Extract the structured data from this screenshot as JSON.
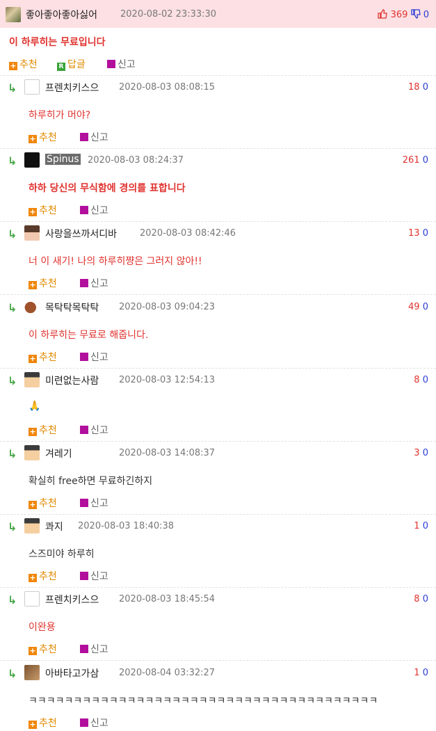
{
  "main_post": {
    "author": "좋아좋아좋아싫어",
    "date": "2020-08-02 23:33:30",
    "up": "369",
    "down": "0",
    "text": "이 하루히는 무료입니다",
    "actions": {
      "recommend": "추천",
      "reply": "답글",
      "report": "신고"
    }
  },
  "action_labels": {
    "recommend": "추천",
    "report": "신고"
  },
  "comments": [
    {
      "author": "프렌치키스으",
      "date": "2020-08-03 08:08:15",
      "up": "18",
      "down": "0",
      "text": "하루히가 머야?",
      "color": "#e0322e",
      "bold": false,
      "avatar": "lips-avatar"
    },
    {
      "author": "Spinus",
      "date": "2020-08-03 08:24:37",
      "up": "261",
      "down": "0",
      "text": "하하 당신의 무식함에 경의를 표합니다",
      "color": "#e0322e",
      "bold": true,
      "avatar": "cat-avatar"
    },
    {
      "author": "사랑을쓰까서디바",
      "date": "2020-08-03 08:42:46",
      "up": "13",
      "down": "0",
      "text": "너 이 새기! 나의 하루히쨩은 그러지 않아!!",
      "color": "#e0322e",
      "bold": false,
      "avatar": "girl-avatar"
    },
    {
      "author": "목탁탁목탁탁",
      "date": "2020-08-03 09:04:23",
      "up": "49",
      "down": "0",
      "text": "이 하루히는 무료로 해줍니다.",
      "color": "#e0322e",
      "bold": false,
      "avatar": "moktak-avatar"
    },
    {
      "author": "미련없는사람",
      "date": "2020-08-03 12:54:13",
      "up": "8",
      "down": "0",
      "text": "🙏",
      "color": "#333333",
      "bold": false,
      "avatar": "pixel-man-avatar"
    },
    {
      "author": "겨레기",
      "date": "2020-08-03 14:08:37",
      "up": "3",
      "down": "0",
      "text": "확실히 free하면 무료하긴하지",
      "color": "#333333",
      "bold": false,
      "avatar": "pixel-man-avatar"
    },
    {
      "author": "콰지",
      "date": "2020-08-03 18:40:38",
      "up": "1",
      "down": "0",
      "text": "스즈미야 하루히",
      "color": "#333333",
      "bold": false,
      "avatar": "pixel-man-avatar"
    },
    {
      "author": "프렌치키스으",
      "date": "2020-08-03 18:45:54",
      "up": "8",
      "down": "0",
      "text": "이완용",
      "color": "#e0322e",
      "bold": false,
      "avatar": "lips-avatar"
    },
    {
      "author": "아바타고가삼",
      "date": "2020-08-04 03:32:27",
      "up": "1",
      "down": "0",
      "text": "ㅋㅋㅋㅋㅋㅋㅋㅋㅋㅋㅋㅋㅋㅋㅋㅋㅋㅋㅋㅋㅋㅋㅋㅋㅋㅋㅋㅋㅋㅋㅋㅋㅋㅋㅋㅋㅋㅋㅋ",
      "color": "#333333",
      "bold": false,
      "avatar": "money-avatar"
    }
  ]
}
